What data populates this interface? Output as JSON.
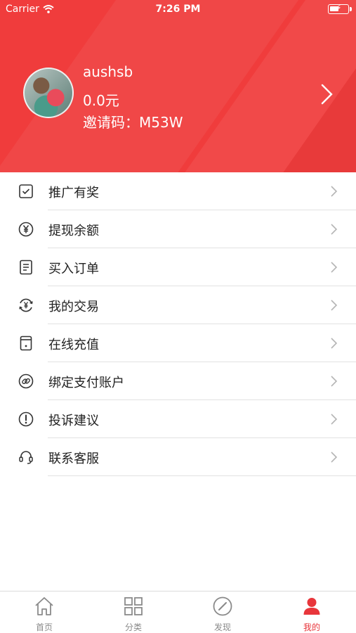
{
  "status_bar": {
    "carrier": "Carrier",
    "time": "7:26 PM"
  },
  "profile": {
    "username": "aushsb",
    "balance": "0.0元",
    "invite_code": "邀请码：M53W"
  },
  "colors": {
    "accent": "#f03c3c",
    "tab_active": "#e8363b",
    "tab_inactive": "#8a8a8a"
  },
  "menu": [
    {
      "label": "推广有奖",
      "icon": "checkbox-icon"
    },
    {
      "label": "提现余额",
      "icon": "yen-circle-icon"
    },
    {
      "label": "买入订单",
      "icon": "document-icon"
    },
    {
      "label": "我的交易",
      "icon": "exchange-yen-icon"
    },
    {
      "label": "在线充值",
      "icon": "device-icon"
    },
    {
      "label": "绑定支付账户",
      "icon": "link-icon"
    },
    {
      "label": "投诉建议",
      "icon": "exclamation-icon"
    },
    {
      "label": "联系客服",
      "icon": "headset-icon"
    }
  ],
  "tabs": [
    {
      "label": "首页",
      "icon": "home-icon"
    },
    {
      "label": "分类",
      "icon": "grid-icon"
    },
    {
      "label": "发现",
      "icon": "compass-icon"
    },
    {
      "label": "我的",
      "icon": "person-icon",
      "active": true
    }
  ]
}
